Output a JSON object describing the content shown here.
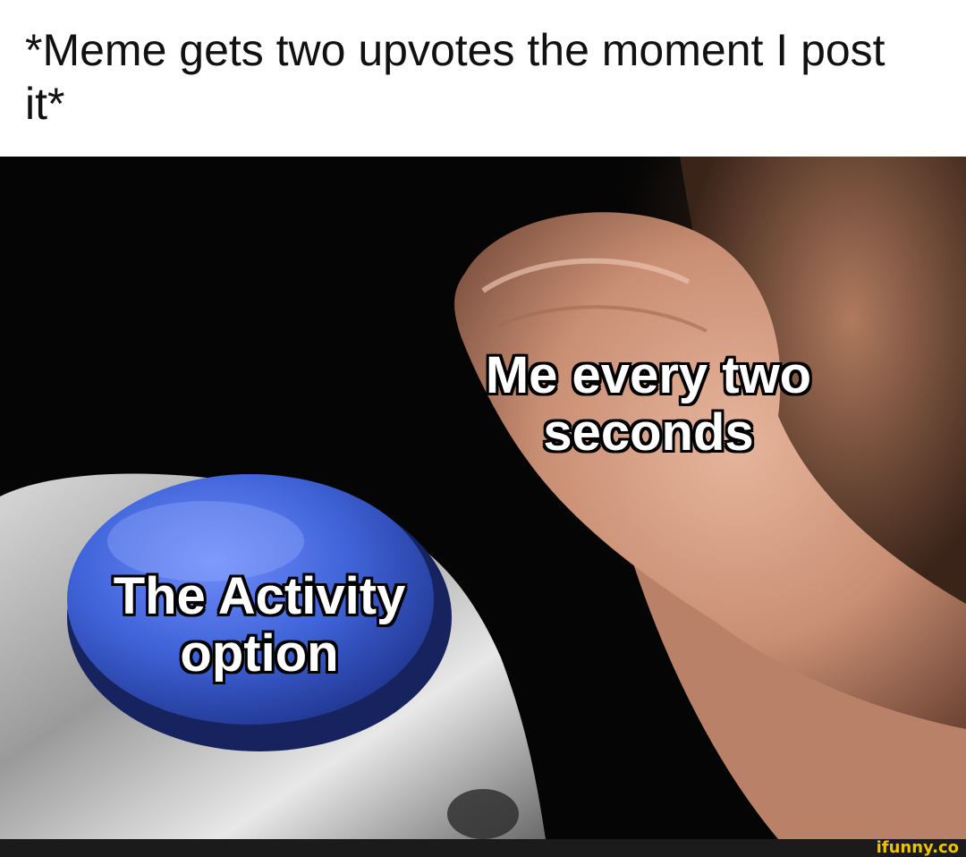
{
  "caption": {
    "line1": "*Meme gets two upvotes the moment I post",
    "line2": "it*"
  },
  "labels": {
    "hand_line1": "Me every two",
    "hand_line2": "seconds",
    "button_line1": "The Activity",
    "button_line2": "option"
  },
  "watermark": "ifunny.co",
  "colors": {
    "button_blue": "#3f63d8",
    "watermark_yellow": "#f2c200",
    "background_dark": "#050505"
  }
}
